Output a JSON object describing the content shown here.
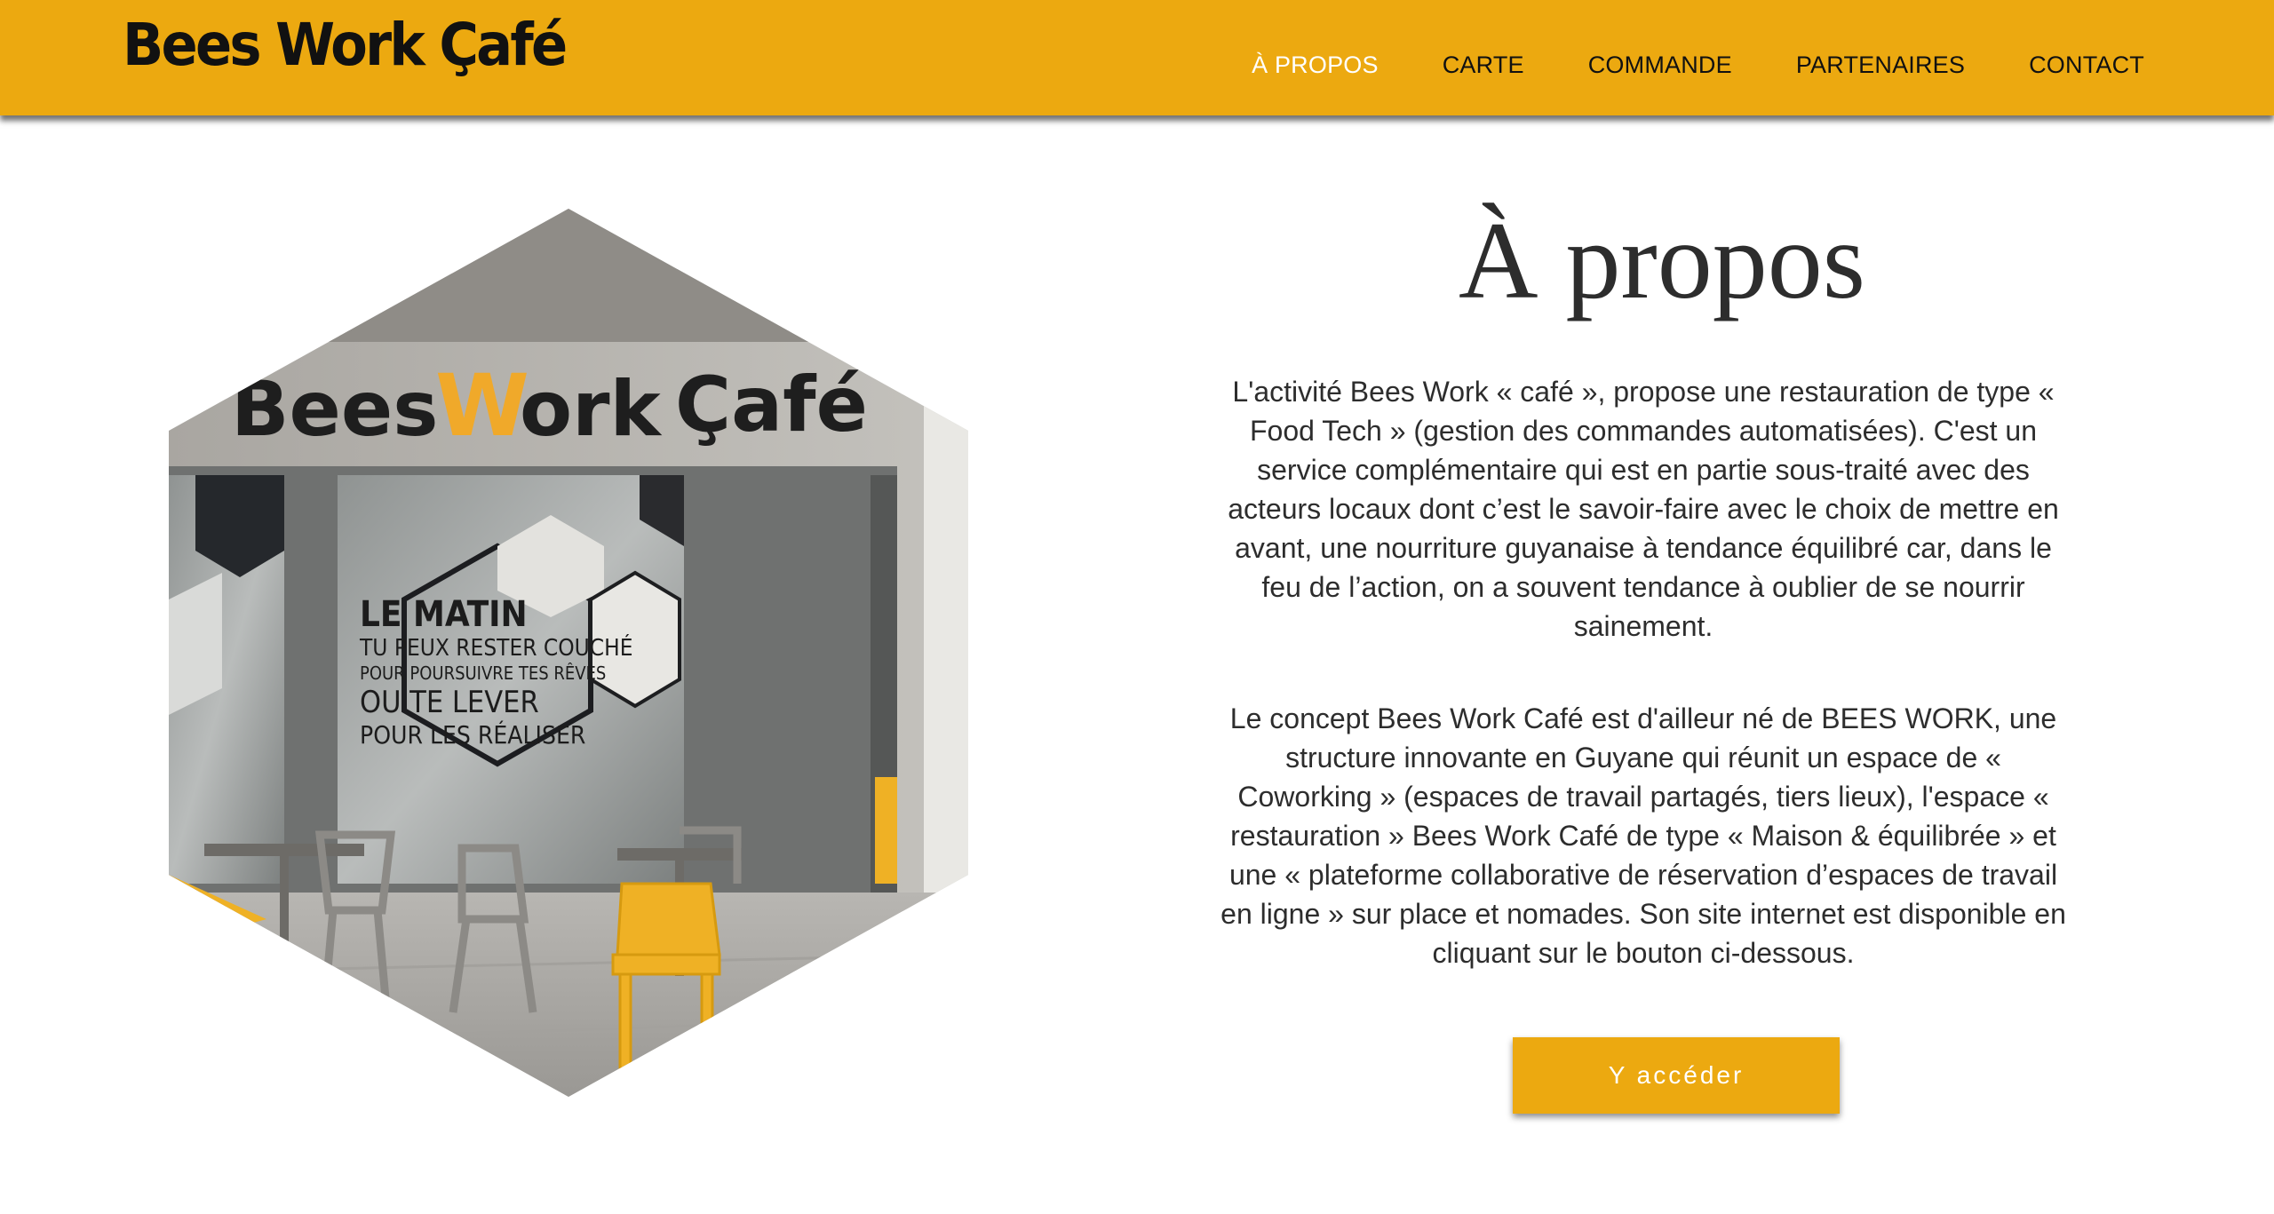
{
  "brand": {
    "logo_text": "Bees Work Çafé"
  },
  "nav": {
    "items": [
      {
        "label": "À PROPOS",
        "active": true
      },
      {
        "label": "CARTE"
      },
      {
        "label": "COMMANDE"
      },
      {
        "label": "PARTENAIRES"
      },
      {
        "label": "CONTACT"
      }
    ]
  },
  "hero": {
    "sign_text": {
      "bees": "Bees",
      "w": "W",
      "ork": "ork",
      "cafe": "Çafé"
    },
    "window_text": [
      "LE MATIN",
      "TU PEUX RESTER COUCHÉ",
      "POUR POURSUIVRE TES RÊVES",
      "OU TE LEVER",
      "POUR LES RÉALISER"
    ]
  },
  "about": {
    "title": "À propos",
    "paragraph_1": "L'activité Bees Work « café », propose une restauration de type « Food Tech » (gestion des commandes automatisées). C'est un service complémentaire qui est en partie sous-traité avec des acteurs locaux dont c’est le savoir-faire avec le choix de mettre en avant, une nourriture guyanaise à tendance équilibré car, dans le feu de l’action, on a souvent tendance à oublier de se nourrir sainement.",
    "paragraph_2": "Le concept Bees Work Café est d'ailleur né de BEES WORK, une structure innovante en Guyane qui réunit un espace de « Coworking » (espaces de travail partagés, tiers lieux), l'espace « restauration » Bees Work Café de type « Maison & équilibrée » et une « plateforme collaborative de réservation d’espaces de travail en ligne » sur place et nomades. Son site internet est disponible en cliquant sur le bouton ci-dessous.",
    "button_label": "Y accéder"
  },
  "colors": {
    "accent": "#eca910",
    "text": "#2d2d2d",
    "nav_active": "#ffffff"
  }
}
